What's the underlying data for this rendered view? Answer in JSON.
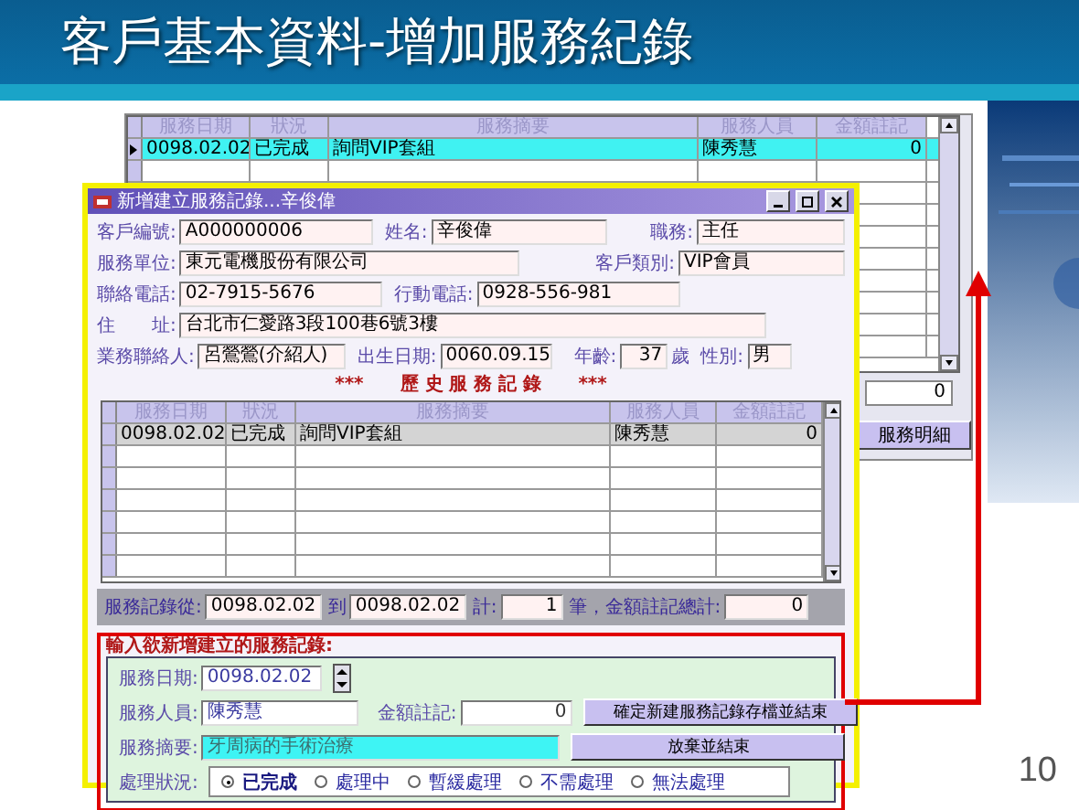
{
  "slide": {
    "title": "客戶基本資料-增加服務紀錄",
    "page_number": "10"
  },
  "back_window": {
    "grid": {
      "columns": [
        "服務日期",
        "狀況",
        "服務摘要",
        "服務人員",
        "金額註記"
      ],
      "rows": [
        {
          "cells": [
            "0098.02.02",
            "已完成",
            "詢問VIP套組",
            "陳秀慧",
            "0"
          ],
          "selected": true
        }
      ]
    },
    "total_field": "0",
    "detail_button": "服務明細"
  },
  "dialog": {
    "title": "新增建立服務記錄...辛俊偉",
    "field_rows": [
      [
        {
          "label": "客戶編號:",
          "value": "A000000006"
        },
        {
          "label": "姓名:",
          "value": "辛俊偉"
        },
        {
          "label": "職務:",
          "value": "主任"
        }
      ],
      [
        {
          "label": "服務單位:",
          "value": "東元電機股份有限公司"
        },
        {
          "label": "客戶類別:",
          "value": "VIP會員"
        }
      ],
      [
        {
          "label": "聯絡電話:",
          "value": "02-7915-5676"
        },
        {
          "label": "行動電話:",
          "value": "0928-556-981"
        }
      ],
      [
        {
          "label": "住　　址:",
          "value": "台北市仁愛路3段100巷6號3樓"
        }
      ],
      [
        {
          "label": "業務聯絡人:",
          "value": "呂鶯鶯(介紹人)"
        },
        {
          "label": "出生日期:",
          "value": "0060.09.15"
        },
        {
          "label": "年齡:",
          "value": "37",
          "unit": "歲"
        },
        {
          "label": "性別:",
          "value": "男"
        }
      ]
    ],
    "history_heading": "***　　歷 史 服 務 記 錄　　***",
    "history_grid": {
      "columns": [
        "服務日期",
        "狀況",
        "服務摘要",
        "服務人員",
        "金額註記"
      ],
      "rows": [
        {
          "cells": [
            "0098.02.02",
            "已完成",
            "詢問VIP套組",
            "陳秀慧",
            "0"
          ],
          "selected": true
        }
      ]
    },
    "summary": [
      {
        "label": "服務記錄從:",
        "value": "0098.02.02"
      },
      {
        "label": "到",
        "value": "0098.02.02"
      },
      {
        "label": "計:",
        "value": "1"
      },
      {
        "label": "筆，金額註記總計:",
        "value": "0"
      }
    ],
    "entry": {
      "heading": "輸入欲新增建立的服務記錄:",
      "date": {
        "label": "服務日期:",
        "value": "0098.02.02"
      },
      "staff": {
        "label": "服務人員:",
        "value": "陳秀慧"
      },
      "amount": {
        "label": "金額註記:",
        "value": "0"
      },
      "description": {
        "label": "服務摘要:",
        "value": "牙周病的手術治療",
        "focused": true
      },
      "save_button": "確定新建服務記錄存檔並結束",
      "cancel_button": "放棄並結束",
      "status": {
        "label": "處理狀況:",
        "options": [
          {
            "label": "已完成",
            "selected": true
          },
          {
            "label": "處理中",
            "selected": false
          },
          {
            "label": "暫緩處理",
            "selected": false
          },
          {
            "label": "不需處理",
            "selected": false
          },
          {
            "label": "無法處理",
            "selected": false
          }
        ]
      }
    }
  }
}
